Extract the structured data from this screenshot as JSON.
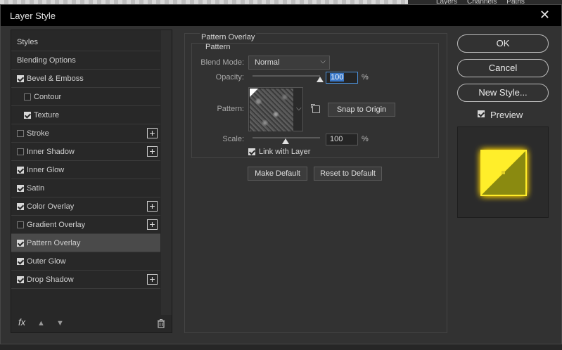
{
  "background": {
    "panel_tabs": [
      "Layers",
      "Channels",
      "Paths"
    ]
  },
  "dialog": {
    "title": "Layer Style",
    "close_icon": "close-icon"
  },
  "styles_list": {
    "items": [
      {
        "label": "Styles",
        "checkbox": null,
        "indent": false,
        "plus": false,
        "selected": false
      },
      {
        "label": "Blending Options",
        "checkbox": null,
        "indent": false,
        "plus": false,
        "selected": false
      },
      {
        "label": "Bevel & Emboss",
        "checkbox": true,
        "indent": false,
        "plus": false,
        "selected": false
      },
      {
        "label": "Contour",
        "checkbox": false,
        "indent": true,
        "plus": false,
        "selected": false
      },
      {
        "label": "Texture",
        "checkbox": true,
        "indent": true,
        "plus": false,
        "selected": false
      },
      {
        "label": "Stroke",
        "checkbox": false,
        "indent": false,
        "plus": true,
        "selected": false
      },
      {
        "label": "Inner Shadow",
        "checkbox": false,
        "indent": false,
        "plus": true,
        "selected": false
      },
      {
        "label": "Inner Glow",
        "checkbox": true,
        "indent": false,
        "plus": false,
        "selected": false
      },
      {
        "label": "Satin",
        "checkbox": true,
        "indent": false,
        "plus": false,
        "selected": false
      },
      {
        "label": "Color Overlay",
        "checkbox": true,
        "indent": false,
        "plus": true,
        "selected": false
      },
      {
        "label": "Gradient Overlay",
        "checkbox": false,
        "indent": false,
        "plus": true,
        "selected": false
      },
      {
        "label": "Pattern Overlay",
        "checkbox": true,
        "indent": false,
        "plus": false,
        "selected": true
      },
      {
        "label": "Outer Glow",
        "checkbox": true,
        "indent": false,
        "plus": false,
        "selected": false
      },
      {
        "label": "Drop Shadow",
        "checkbox": true,
        "indent": false,
        "plus": true,
        "selected": false
      }
    ],
    "footer": {
      "fx_label": "fx",
      "icons": [
        "fx-icon",
        "move-up-icon",
        "move-down-icon",
        "trash-icon"
      ]
    }
  },
  "pattern_overlay": {
    "section_title": "Pattern Overlay",
    "group_title": "Pattern",
    "blend_mode_label": "Blend Mode:",
    "blend_mode_value": "Normal",
    "opacity_label": "Opacity:",
    "opacity_value": "100",
    "opacity_level": 1.0,
    "pattern_label": "Pattern:",
    "snap_button": "Snap to Origin",
    "scale_label": "Scale:",
    "scale_value": "100",
    "percent": "%",
    "link_label": "Link with Layer",
    "link_checked": true,
    "make_default_button": "Make Default",
    "reset_default_button": "Reset to Default"
  },
  "actions": {
    "ok": "OK",
    "cancel": "Cancel",
    "new_style": "New Style...",
    "preview_label": "Preview",
    "preview_checked": true
  },
  "colors": {
    "accent": "#3a78c8",
    "preview_yellow": "#ffee2a",
    "preview_dark": "#8a8a10"
  }
}
